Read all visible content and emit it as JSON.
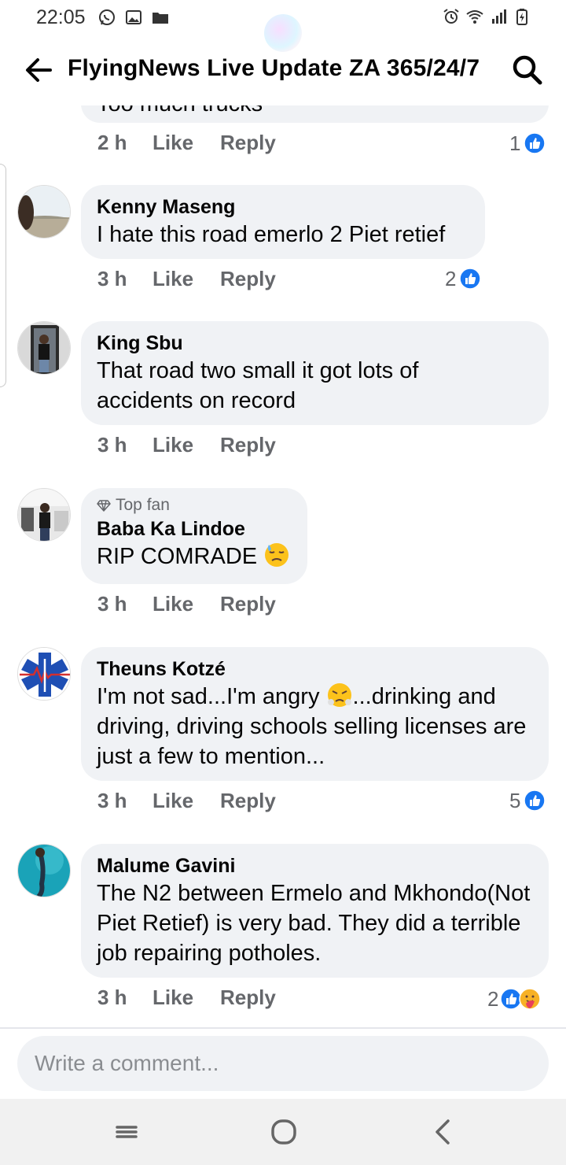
{
  "status_bar": {
    "time": "22:05",
    "left_icons": [
      "whatsapp-icon",
      "gallery-icon",
      "folder-icon"
    ],
    "right_icons": [
      "alarm-icon",
      "wifi-icon",
      "signal-icon",
      "battery-charging-icon"
    ]
  },
  "header": {
    "title": "FlyingNews Live Update ZA 365/24/7",
    "back_icon": "arrow-left-icon",
    "search_icon": "search-icon"
  },
  "clipped_comment": {
    "text": "Too much trucks",
    "time": "2 h",
    "like_label": "Like",
    "reply_label": "Reply",
    "reaction_count": "1"
  },
  "comments": [
    {
      "author": "Kenny Maseng",
      "text": "I hate this road emerlo 2 Piet retief",
      "time": "3 h",
      "like_label": "Like",
      "reply_label": "Reply",
      "reaction_count": "2",
      "reactions": [
        "like"
      ]
    },
    {
      "author": "King Sbu",
      "text": "That road two small it got lots of accidents on record",
      "time": "3 h",
      "like_label": "Like",
      "reply_label": "Reply",
      "reaction_count": "",
      "reactions": []
    },
    {
      "badge": "Top fan",
      "author": "Baba Ka Lindoe",
      "text": "RIP COMRADE",
      "emoji": "sad-sweat-emoji",
      "time": "3 h",
      "like_label": "Like",
      "reply_label": "Reply",
      "reaction_count": "",
      "reactions": []
    },
    {
      "author": "Theuns Kotzé",
      "text_before_emoji": "I'm not sad...I'm angry",
      "emoji": "angry-steam-emoji",
      "text_after_emoji": "...drinking and driving,  driving schools selling licenses are just a few to mention...",
      "time": "3 h",
      "like_label": "Like",
      "reply_label": "Reply",
      "reaction_count": "5",
      "reactions": [
        "like"
      ]
    },
    {
      "author": "Malume Gavini",
      "text": "The N2 between Ermelo and Mkhondo(Not Piet Retief) is very bad. They did a terrible job repairing potholes.",
      "time": "3 h",
      "like_label": "Like",
      "reply_label": "Reply",
      "reaction_count": "2",
      "reactions": [
        "like",
        "care"
      ]
    }
  ],
  "composer": {
    "placeholder": "Write a comment..."
  },
  "navbar": {
    "icons": [
      "recent-apps-icon",
      "home-icon",
      "back-icon"
    ]
  },
  "colors": {
    "bubble": "#f0f2f5",
    "meta_text": "#65676b",
    "like_blue": "#1877f2",
    "text": "#050505"
  }
}
